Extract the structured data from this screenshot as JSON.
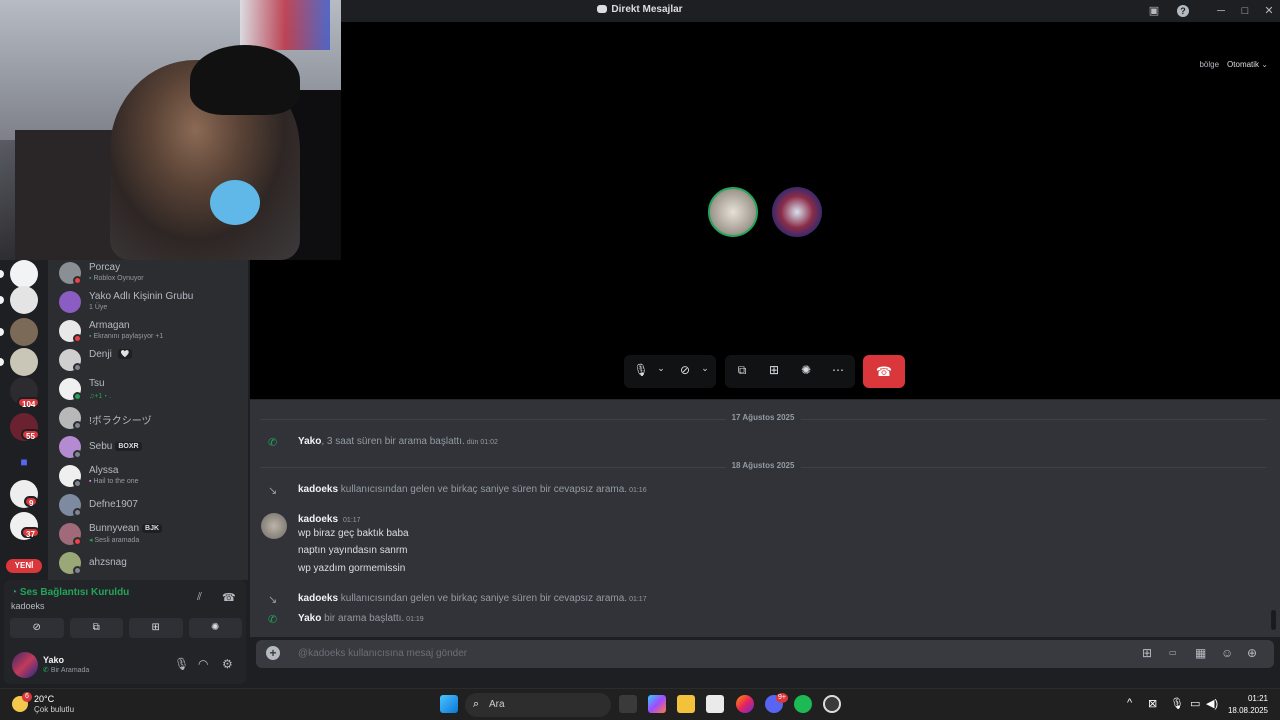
{
  "window": {
    "title": "Direkt Mesajlar"
  },
  "call": {
    "region_label": "bölge",
    "region_value": "Otomatik"
  },
  "rail": {
    "badges": [
      "104",
      "55",
      "9",
      "37"
    ],
    "new_label": "YENİ"
  },
  "dm_list": [
    {
      "name": "Porcay",
      "sub": "Roblox Oynuyor",
      "status": "dnd"
    },
    {
      "name": "Yako Adlı Kişinin Grubu",
      "sub": "1 Üye",
      "status": ""
    },
    {
      "name": "Armagan",
      "sub": "Ekranını paylaşıyor +1",
      "status": "dnd"
    },
    {
      "name": "Denji",
      "sub": "",
      "status": "offline",
      "emoji": "🤍"
    },
    {
      "name": "Tsu",
      "sub": "♫+1・.",
      "status": "online"
    },
    {
      "name": "!ボラクシーヅ",
      "sub": "",
      "status": "offline"
    },
    {
      "name": "Sebu",
      "sub": "",
      "status": "offline",
      "tag": "BOXR"
    },
    {
      "name": "Alyssa",
      "sub": "Hail to the one",
      "status": "offline"
    },
    {
      "name": "Defne1907",
      "sub": "",
      "status": "offline"
    },
    {
      "name": "Bunnyvean",
      "sub": "Sesli aramada",
      "status": "dnd",
      "tag": "BJK"
    },
    {
      "name": "ahzsnag",
      "sub": "",
      "status": "offline"
    }
  ],
  "voice": {
    "title": "Ses Bağlantısı Kuruldu",
    "channel": "kadoeks"
  },
  "user": {
    "name": "Yako",
    "status": "Bir Aramada"
  },
  "chat": {
    "date1": "17 Ağustos 2025",
    "date2": "18 Ağustos 2025",
    "sys1": {
      "user": "Yako",
      "text": ", 3 saat süren bir arama başlattı.",
      "time": "dün 01:02"
    },
    "sys2": {
      "user": "kadoeks",
      "text": " kullanıcısından gelen ve birkaç saniye süren bir cevapsız arama.",
      "time": "01:16"
    },
    "msg": {
      "author": "kadoeks",
      "time": "01:17",
      "lines": [
        "wp biraz geç baktık baba",
        "naptın yayındasın sanrm",
        "wp yazdım gormemissin"
      ]
    },
    "sys3": {
      "user": "kadoeks",
      "text": " kullanıcısından gelen ve birkaç saniye süren bir cevapsız arama.",
      "time": "01:17"
    },
    "sys4": {
      "user": "Yako",
      "text": " bir arama başlattı.",
      "time": "01:19"
    },
    "placeholder": "@kadoeks kullanıcısına mesaj gönder"
  },
  "taskbar": {
    "temp": "20°C",
    "weather": "Çok bulutlu",
    "weather_badge": "6",
    "search": "Ara",
    "discord_badge": "9+",
    "time": "01:21",
    "date": "18.08.2025"
  }
}
